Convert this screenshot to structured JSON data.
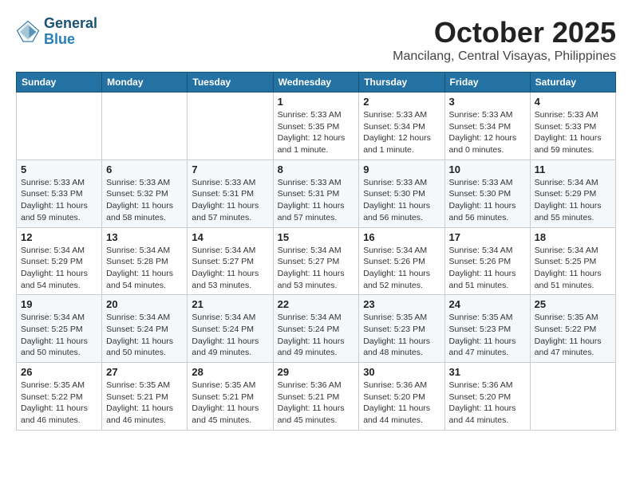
{
  "header": {
    "logo_line1": "General",
    "logo_line2": "Blue",
    "month": "October 2025",
    "location": "Mancilang, Central Visayas, Philippines"
  },
  "weekdays": [
    "Sunday",
    "Monday",
    "Tuesday",
    "Wednesday",
    "Thursday",
    "Friday",
    "Saturday"
  ],
  "weeks": [
    [
      {
        "day": "",
        "info": ""
      },
      {
        "day": "",
        "info": ""
      },
      {
        "day": "",
        "info": ""
      },
      {
        "day": "1",
        "info": "Sunrise: 5:33 AM\nSunset: 5:35 PM\nDaylight: 12 hours\nand 1 minute."
      },
      {
        "day": "2",
        "info": "Sunrise: 5:33 AM\nSunset: 5:34 PM\nDaylight: 12 hours\nand 1 minute."
      },
      {
        "day": "3",
        "info": "Sunrise: 5:33 AM\nSunset: 5:34 PM\nDaylight: 12 hours\nand 0 minutes."
      },
      {
        "day": "4",
        "info": "Sunrise: 5:33 AM\nSunset: 5:33 PM\nDaylight: 11 hours\nand 59 minutes."
      }
    ],
    [
      {
        "day": "5",
        "info": "Sunrise: 5:33 AM\nSunset: 5:33 PM\nDaylight: 11 hours\nand 59 minutes."
      },
      {
        "day": "6",
        "info": "Sunrise: 5:33 AM\nSunset: 5:32 PM\nDaylight: 11 hours\nand 58 minutes."
      },
      {
        "day": "7",
        "info": "Sunrise: 5:33 AM\nSunset: 5:31 PM\nDaylight: 11 hours\nand 57 minutes."
      },
      {
        "day": "8",
        "info": "Sunrise: 5:33 AM\nSunset: 5:31 PM\nDaylight: 11 hours\nand 57 minutes."
      },
      {
        "day": "9",
        "info": "Sunrise: 5:33 AM\nSunset: 5:30 PM\nDaylight: 11 hours\nand 56 minutes."
      },
      {
        "day": "10",
        "info": "Sunrise: 5:33 AM\nSunset: 5:30 PM\nDaylight: 11 hours\nand 56 minutes."
      },
      {
        "day": "11",
        "info": "Sunrise: 5:34 AM\nSunset: 5:29 PM\nDaylight: 11 hours\nand 55 minutes."
      }
    ],
    [
      {
        "day": "12",
        "info": "Sunrise: 5:34 AM\nSunset: 5:29 PM\nDaylight: 11 hours\nand 54 minutes."
      },
      {
        "day": "13",
        "info": "Sunrise: 5:34 AM\nSunset: 5:28 PM\nDaylight: 11 hours\nand 54 minutes."
      },
      {
        "day": "14",
        "info": "Sunrise: 5:34 AM\nSunset: 5:27 PM\nDaylight: 11 hours\nand 53 minutes."
      },
      {
        "day": "15",
        "info": "Sunrise: 5:34 AM\nSunset: 5:27 PM\nDaylight: 11 hours\nand 53 minutes."
      },
      {
        "day": "16",
        "info": "Sunrise: 5:34 AM\nSunset: 5:26 PM\nDaylight: 11 hours\nand 52 minutes."
      },
      {
        "day": "17",
        "info": "Sunrise: 5:34 AM\nSunset: 5:26 PM\nDaylight: 11 hours\nand 51 minutes."
      },
      {
        "day": "18",
        "info": "Sunrise: 5:34 AM\nSunset: 5:25 PM\nDaylight: 11 hours\nand 51 minutes."
      }
    ],
    [
      {
        "day": "19",
        "info": "Sunrise: 5:34 AM\nSunset: 5:25 PM\nDaylight: 11 hours\nand 50 minutes."
      },
      {
        "day": "20",
        "info": "Sunrise: 5:34 AM\nSunset: 5:24 PM\nDaylight: 11 hours\nand 50 minutes."
      },
      {
        "day": "21",
        "info": "Sunrise: 5:34 AM\nSunset: 5:24 PM\nDaylight: 11 hours\nand 49 minutes."
      },
      {
        "day": "22",
        "info": "Sunrise: 5:34 AM\nSunset: 5:24 PM\nDaylight: 11 hours\nand 49 minutes."
      },
      {
        "day": "23",
        "info": "Sunrise: 5:35 AM\nSunset: 5:23 PM\nDaylight: 11 hours\nand 48 minutes."
      },
      {
        "day": "24",
        "info": "Sunrise: 5:35 AM\nSunset: 5:23 PM\nDaylight: 11 hours\nand 47 minutes."
      },
      {
        "day": "25",
        "info": "Sunrise: 5:35 AM\nSunset: 5:22 PM\nDaylight: 11 hours\nand 47 minutes."
      }
    ],
    [
      {
        "day": "26",
        "info": "Sunrise: 5:35 AM\nSunset: 5:22 PM\nDaylight: 11 hours\nand 46 minutes."
      },
      {
        "day": "27",
        "info": "Sunrise: 5:35 AM\nSunset: 5:21 PM\nDaylight: 11 hours\nand 46 minutes."
      },
      {
        "day": "28",
        "info": "Sunrise: 5:35 AM\nSunset: 5:21 PM\nDaylight: 11 hours\nand 45 minutes."
      },
      {
        "day": "29",
        "info": "Sunrise: 5:36 AM\nSunset: 5:21 PM\nDaylight: 11 hours\nand 45 minutes."
      },
      {
        "day": "30",
        "info": "Sunrise: 5:36 AM\nSunset: 5:20 PM\nDaylight: 11 hours\nand 44 minutes."
      },
      {
        "day": "31",
        "info": "Sunrise: 5:36 AM\nSunset: 5:20 PM\nDaylight: 11 hours\nand 44 minutes."
      },
      {
        "day": "",
        "info": ""
      }
    ]
  ]
}
